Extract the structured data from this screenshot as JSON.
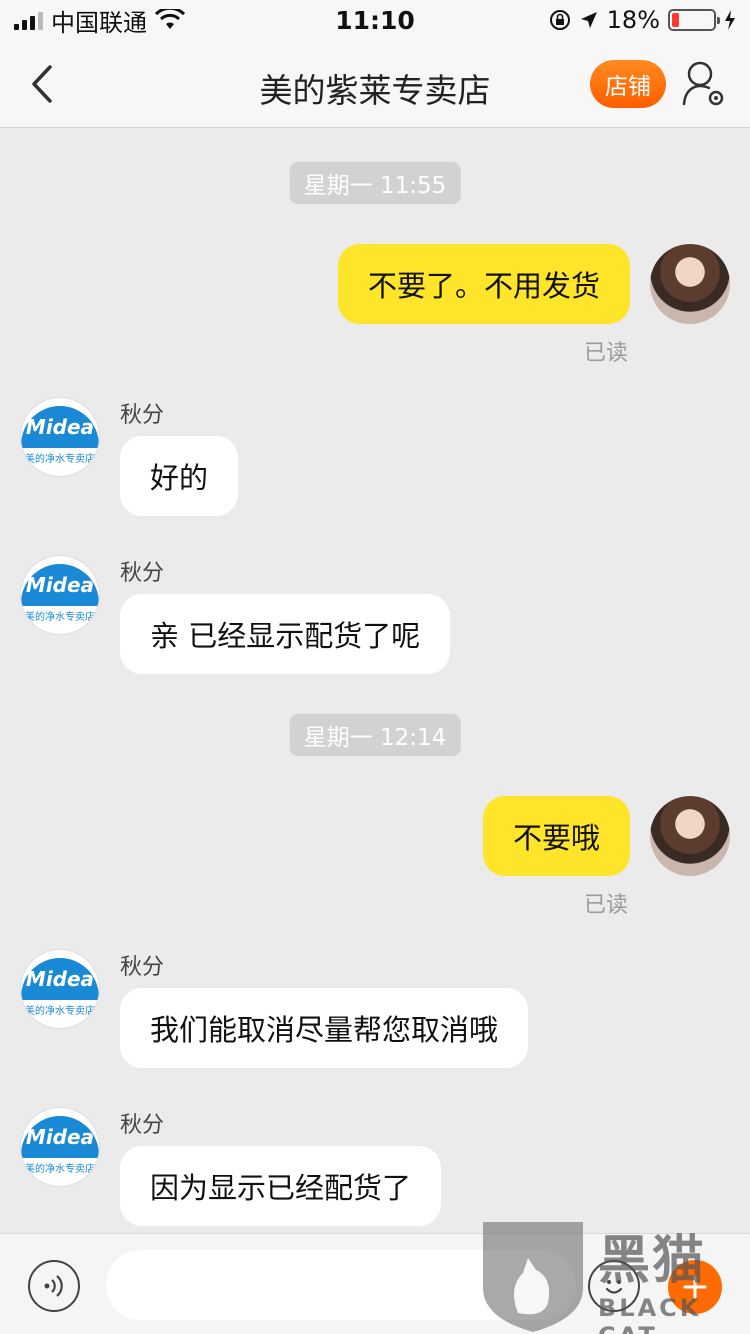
{
  "status_bar": {
    "carrier": "中国联通",
    "time": "11:10",
    "battery_percent": "18%",
    "battery_level": 0.18,
    "icons": [
      "signal-icon",
      "wifi-icon",
      "rotation-lock-icon",
      "location-arrow-icon",
      "battery-icon",
      "charging-bolt-icon"
    ]
  },
  "nav": {
    "title": "美的紫莱专卖店",
    "store_button": "店铺",
    "back_icon": "chevron-left-icon",
    "profile_icon": "user-settings-icon",
    "accent_color": "#ff6b00"
  },
  "chat": {
    "timestamps": [
      "星期一 11:55",
      "星期一 12:14"
    ],
    "messages": [
      {
        "direction": "out",
        "text": "不要了。不用发货",
        "status": "已读"
      },
      {
        "direction": "in",
        "sender": "秋分",
        "text": "好的"
      },
      {
        "direction": "in",
        "sender": "秋分",
        "text": "亲  已经显示配货了呢"
      },
      {
        "direction": "out",
        "text": "不要哦",
        "status": "已读"
      },
      {
        "direction": "in",
        "sender": "秋分",
        "text": "我们能取消尽量帮您取消哦"
      },
      {
        "direction": "in",
        "sender": "秋分",
        "text": "因为显示已经配货了"
      }
    ],
    "shop_avatar": {
      "brand": "Midea",
      "caption": "美的净水专卖店"
    },
    "outgoing_bubble_color": "#ffe52a",
    "incoming_bubble_color": "#ffffff"
  },
  "input_bar": {
    "placeholder": "",
    "icons": [
      "voice-icon",
      "emoji-icon",
      "plus-icon"
    ]
  },
  "watermark": {
    "title": "黑猫",
    "subtitle": "BLACK CAT"
  }
}
